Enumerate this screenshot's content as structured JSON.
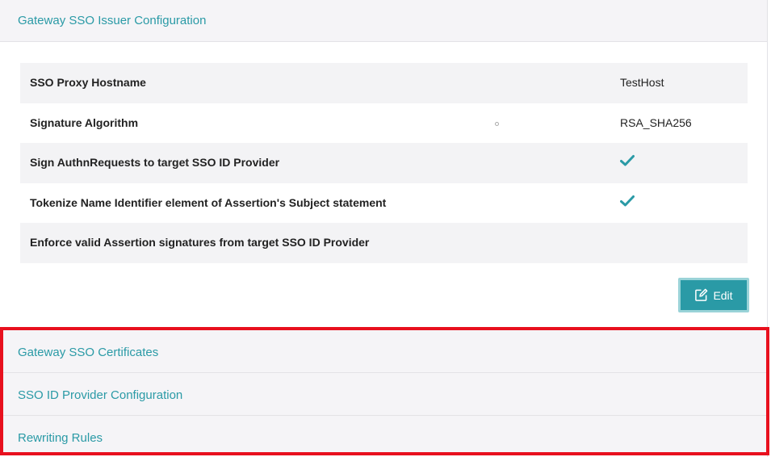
{
  "header": {
    "title": "Gateway SSO Issuer Configuration"
  },
  "config": {
    "rows": [
      {
        "label": "SSO Proxy Hostname",
        "value": "TestHost"
      },
      {
        "label": "Signature Algorithm",
        "value": "RSA_SHA256"
      },
      {
        "label": "Sign AuthnRequests to target SSO ID Provider",
        "value": "",
        "checked": true
      },
      {
        "label": "Tokenize Name Identifier element of Assertion's Subject statement",
        "value": "",
        "checked": true
      },
      {
        "label": "Enforce valid Assertion signatures from target SSO ID Provider",
        "value": "",
        "checked": false
      }
    ]
  },
  "actions": {
    "edit_label": "Edit"
  },
  "sections": [
    {
      "title": "Gateway SSO Certificates"
    },
    {
      "title": "SSO ID Provider Configuration"
    },
    {
      "title": "Rewriting Rules"
    }
  ],
  "colors": {
    "accent": "#2a9aa6",
    "highlight_border": "#e8101e"
  },
  "icons": {
    "check": "check-icon",
    "edit": "edit-icon"
  }
}
